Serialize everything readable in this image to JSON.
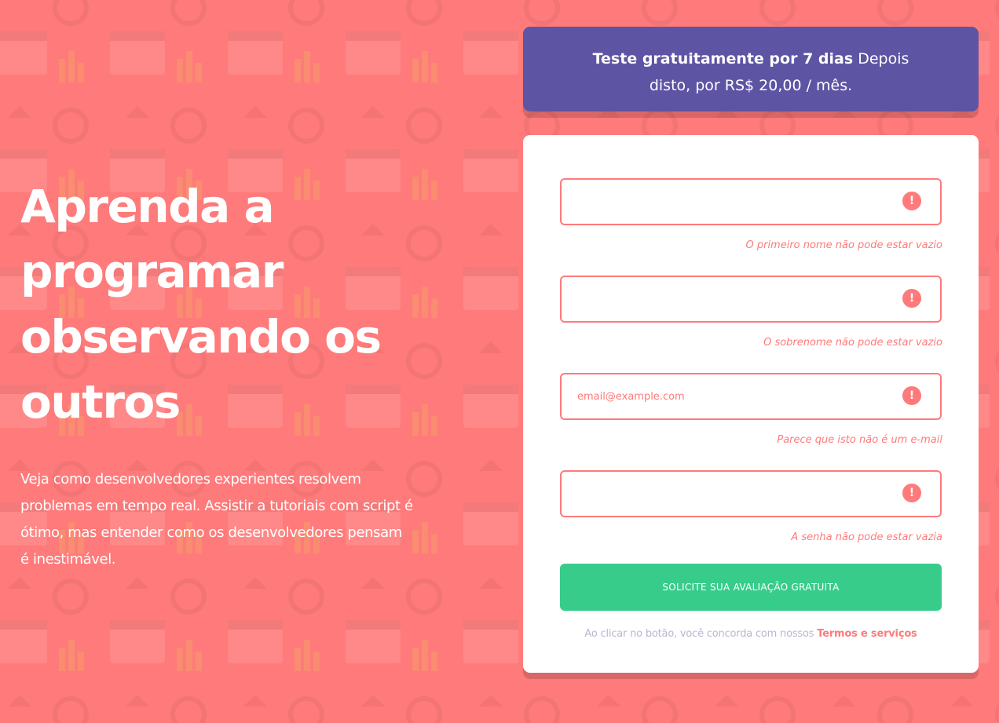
{
  "hero": {
    "title": "Aprenda a programar observando os outros",
    "text": "Veja como desenvolvedores experientes resolvem problemas em tempo real. Assistir a tutoriais com script é ótimo, mas entender como os desenvolvedores pensam é inestimável."
  },
  "offer": {
    "strong": "Teste gratuitamente por 7 dias",
    "rest_line1": "Depois",
    "line2": "disto, por RS$ 20,00 / mês."
  },
  "form": {
    "first_name": {
      "value": "",
      "error": "O primeiro nome não pode estar vazio"
    },
    "last_name": {
      "value": "",
      "error": "O sobrenome não pode estar vazio"
    },
    "email": {
      "value": "email@example.com",
      "error": "Parece que isto não é um e-mail"
    },
    "password": {
      "value": "",
      "error": "A senha não pode estar vazia"
    },
    "error_glyph": "!",
    "submit_label": "SOLICITE SUA AVALIAÇÃO GRATUITA",
    "terms_text": "Ao clicar no botão, você concorda com nossos",
    "terms_link": "Termos e serviços"
  },
  "colors": {
    "background": "#ff7a7a",
    "banner": "#5e54a4",
    "button": "#38cc8b",
    "error": "#ff7a7a",
    "muted": "#b9b6d3"
  },
  "icons": [
    "error-icon"
  ]
}
